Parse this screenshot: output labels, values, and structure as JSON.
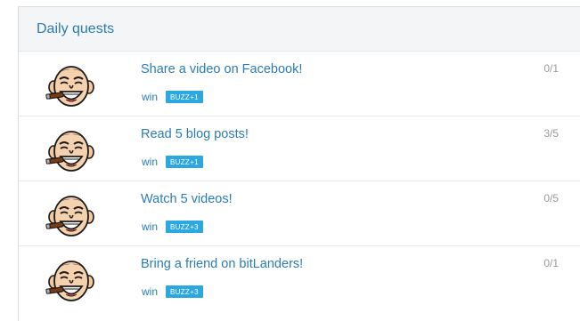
{
  "panel": {
    "title": "Daily quests"
  },
  "quests": [
    {
      "title": "Share a video on Facebook!",
      "reward_label": "win",
      "badge": "BUZZ+1",
      "progress": "0/1"
    },
    {
      "title": "Read 5 blog posts!",
      "reward_label": "win",
      "badge": "BUZZ+1",
      "progress": "3/5"
    },
    {
      "title": "Watch 5 videos!",
      "reward_label": "win",
      "badge": "BUZZ+3",
      "progress": "0/5"
    },
    {
      "title": "Bring a friend on bitLanders!",
      "reward_label": "win",
      "badge": "BUZZ+3",
      "progress": "0/1"
    }
  ],
  "icons": {
    "avatar": "laughing-cigar-face-icon"
  },
  "colors": {
    "link": "#2a7cb8",
    "badge": "#2da7e0",
    "header_bg": "#f4f5f7",
    "progress_text": "#9a9a9a"
  }
}
